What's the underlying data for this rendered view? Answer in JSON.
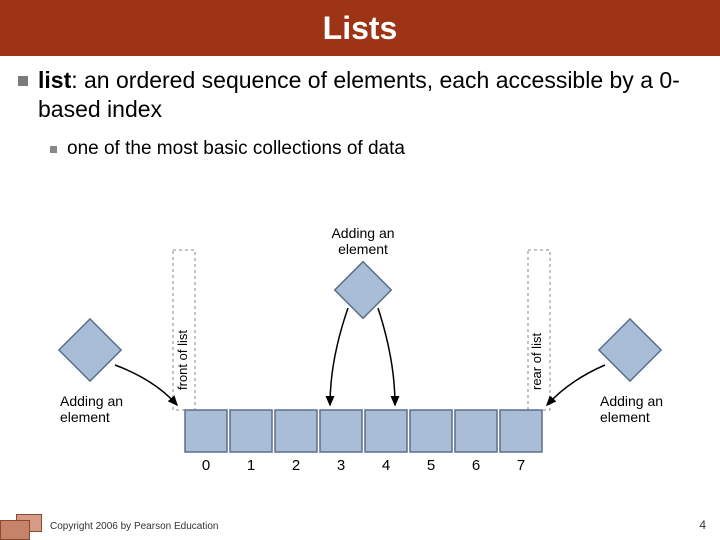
{
  "title": "Lists",
  "term": "list",
  "definition": ": an ordered sequence of elements, each accessible by a 0-based index",
  "sub": "one of the most basic collections of data",
  "diagram": {
    "addElementTop": "Adding an element",
    "addElementLeft": "Adding an element",
    "addElementRight": "Adding an element",
    "frontLabel": "front of list",
    "rearLabel": "rear of list",
    "indices": [
      "0",
      "1",
      "2",
      "3",
      "4",
      "5",
      "6",
      "7"
    ]
  },
  "footer": "Copyright 2006 by Pearson Education",
  "pageNumber": "4"
}
